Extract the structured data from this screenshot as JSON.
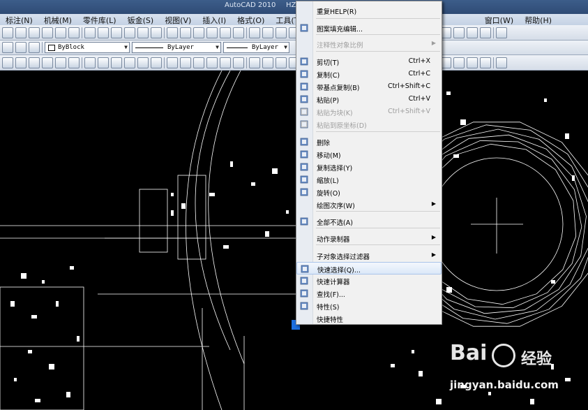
{
  "window": {
    "title": "AutoCAD 2010",
    "title_fragment": "HZ"
  },
  "menubar": {
    "items": [
      "标注(N)",
      "机械(M)",
      "零件库(L)",
      "钣金(S)",
      "视图(V)",
      "插入(I)",
      "格式(O)",
      "工具(T)",
      "",
      "",
      "窗口(W)",
      "帮助(H)"
    ]
  },
  "toolbar": {
    "color_combo": "ByBlock",
    "linetype_combo": "ByLayer",
    "lineweight_combo": "ByLayer"
  },
  "context_menu": {
    "items": [
      {
        "label": "重复HELP(R)",
        "shortcut": "",
        "icon": "none",
        "disabled": false,
        "submenu": false
      },
      {
        "label": "图案填充编辑...",
        "shortcut": "",
        "icon": "hatch-edit-icon",
        "disabled": false,
        "submenu": false
      },
      {
        "label": "注释性对象比例",
        "shortcut": "",
        "icon": "none",
        "disabled": true,
        "submenu": true
      },
      {
        "label": "剪切(T)",
        "shortcut": "Ctrl+X",
        "icon": "scissors-icon",
        "disabled": false,
        "submenu": false
      },
      {
        "label": "复制(C)",
        "shortcut": "Ctrl+C",
        "icon": "copy-icon",
        "disabled": false,
        "submenu": false
      },
      {
        "label": "带基点复制(B)",
        "shortcut": "Ctrl+Shift+C",
        "icon": "copy-base-icon",
        "disabled": false,
        "submenu": false
      },
      {
        "label": "粘贴(P)",
        "shortcut": "Ctrl+V",
        "icon": "paste-icon",
        "disabled": false,
        "submenu": false
      },
      {
        "label": "粘贴为块(K)",
        "shortcut": "Ctrl+Shift+V",
        "icon": "paste-block-icon",
        "disabled": true,
        "submenu": false
      },
      {
        "label": "粘贴到原坐标(D)",
        "shortcut": "",
        "icon": "paste-orig-icon",
        "disabled": true,
        "submenu": false
      },
      {
        "label": "删除",
        "shortcut": "",
        "icon": "eraser-icon",
        "disabled": false,
        "submenu": false
      },
      {
        "label": "移动(M)",
        "shortcut": "",
        "icon": "move-icon",
        "disabled": false,
        "submenu": false
      },
      {
        "label": "复制选择(Y)",
        "shortcut": "",
        "icon": "copy-select-icon",
        "disabled": false,
        "submenu": false
      },
      {
        "label": "缩放(L)",
        "shortcut": "",
        "icon": "scale-icon",
        "disabled": false,
        "submenu": false
      },
      {
        "label": "旋转(O)",
        "shortcut": "",
        "icon": "rotate-icon",
        "disabled": false,
        "submenu": false
      },
      {
        "label": "绘图次序(W)",
        "shortcut": "",
        "icon": "none",
        "disabled": false,
        "submenu": true
      },
      {
        "label": "全部不选(A)",
        "shortcut": "",
        "icon": "deselect-icon",
        "disabled": false,
        "submenu": false
      },
      {
        "label": "动作录制器",
        "shortcut": "",
        "icon": "none",
        "disabled": false,
        "submenu": true
      },
      {
        "label": "子对象选择过滤器",
        "shortcut": "",
        "icon": "none",
        "disabled": false,
        "submenu": true
      },
      {
        "label": "快速选择(Q)...",
        "shortcut": "",
        "icon": "quick-select-icon",
        "disabled": false,
        "submenu": false
      },
      {
        "label": "快速计算器",
        "shortcut": "",
        "icon": "calculator-icon",
        "disabled": false,
        "submenu": false
      },
      {
        "label": "查找(F)...",
        "shortcut": "",
        "icon": "find-icon",
        "disabled": false,
        "submenu": false
      },
      {
        "label": "特性(S)",
        "shortcut": "",
        "icon": "properties-icon",
        "disabled": false,
        "submenu": false
      },
      {
        "label": "快捷特性",
        "shortcut": "",
        "icon": "none",
        "disabled": false,
        "submenu": false
      }
    ],
    "highlighted_index": 18
  },
  "watermark": {
    "logo_text": "Bai",
    "logo_suffix": "经验",
    "url": "jingyan.baidu.com"
  }
}
